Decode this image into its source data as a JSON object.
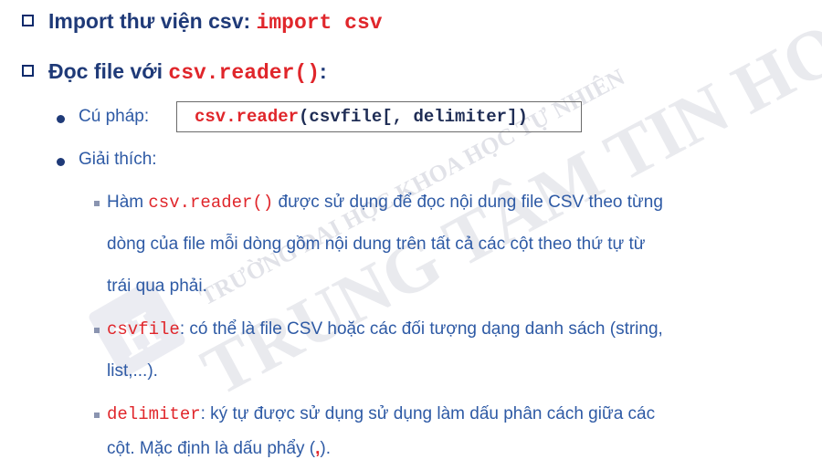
{
  "watermark": {
    "line1": "TRƯỜNG ĐẠI HỌC KHOA HỌC TỰ NHIÊN",
    "line2": "TRUNG TÂM TIN HỌC"
  },
  "heading1": {
    "label": "Import thư viện csv: ",
    "code": "import csv"
  },
  "heading2": {
    "label": "Đọc file với ",
    "code": "csv.reader()",
    "suffix": ":"
  },
  "syntax": {
    "label": "Cú pháp:",
    "code_func": "csv.reader",
    "code_args": "(csvfile[, delimiter])"
  },
  "explain": {
    "label": "Giải thích:",
    "item1": {
      "code": "csv.reader()",
      "line1_rest": " được sử dụng để đọc nội dung file CSV theo từng",
      "line1_prefix": "Hàm ",
      "line2": "dòng của file mỗi dòng gồm nội dung trên tất cả các cột theo thứ tự từ",
      "line3": "trái qua phải."
    },
    "item2": {
      "code": "csvfile",
      "line1_rest": ": có thể là file CSV hoặc các đối tượng dạng danh sách (string,",
      "line2": "list,...)."
    },
    "item3": {
      "code": "delimiter",
      "line1_rest": ": ký tự được sử dụng sử dụng làm dấu phân cách giữa các",
      "line2_a": "cột. Mặc định là dấu phẩy (",
      "line2_comma": ",",
      "line2_b": ")."
    }
  }
}
